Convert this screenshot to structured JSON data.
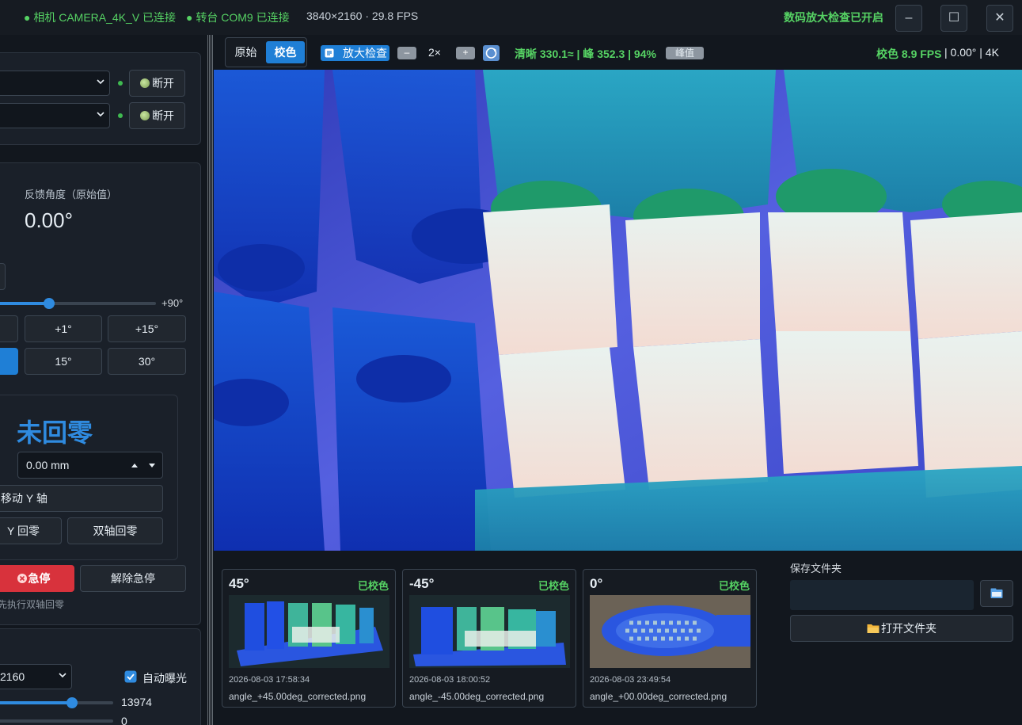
{
  "titlebar": {
    "camera_status": "● 相机 CAMERA_4K_V 已连接",
    "turntable_status": "● 转台 COM9 已连接",
    "resolution": "3840×2160 · 29.8 FPS",
    "zoom_status": "数码放大检查已开启",
    "minimize": "–",
    "maximize": "☐",
    "close": "✕"
  },
  "connection": {
    "disconnect_label_1": "断开",
    "disconnect_label_2": "断开"
  },
  "angle": {
    "feedback_label": "反馈角度（原始值）",
    "feedback_value": "0.00°",
    "slider_max_label": "+90°",
    "slider_level_fraction": 0.56,
    "step_buttons": [
      "+1°",
      "+15°"
    ],
    "preset_buttons": [
      "15°",
      "30°"
    ]
  },
  "axis": {
    "home_status": "未回零",
    "position_value": "0.00 mm",
    "move_y": "移动 Y 轴",
    "y_home": "Y 回零",
    "dual_home": "双轴回零",
    "estop": "急停",
    "release_estop": "解除急停",
    "hint": "先执行双轴回零"
  },
  "camera": {
    "resolution_select": "2160",
    "auto_exposure": "自动曝光",
    "exposure_value": "13974",
    "gain_value": "0",
    "exposure_level_fraction": 0.66,
    "gain_level_fraction": 0.0
  },
  "toolbar": {
    "view_original": "原始",
    "view_corrected": "校色",
    "zoom_check": "放大检查",
    "zoom_minus": "–",
    "zoom_level": "2×",
    "zoom_plus": "+",
    "sharpness_stats": "清晰 330.1≈ | 峰 352.3 | 94%",
    "peak_toggle": "峰值",
    "corrected_fps": "校色 8.9 FPS",
    "rotation": "| 0.00° | 4K"
  },
  "thumbnails": [
    {
      "angle": "45°",
      "status": "已校色",
      "time": "2026-08-03 17:58:34",
      "file": "angle_+45.00deg_corrected.png"
    },
    {
      "angle": "-45°",
      "status": "已校色",
      "time": "2026-08-03 18:00:52",
      "file": "angle_-45.00deg_corrected.png"
    },
    {
      "angle": "0°",
      "status": "已校色",
      "time": "2026-08-03 23:49:54",
      "file": "angle_+00.00deg_corrected.png"
    }
  ],
  "save": {
    "folder_label": "保存文件夹",
    "folder_value": "",
    "open_folder": "打开文件夹"
  },
  "colors": {
    "accent": "#1f7fd6",
    "ok_green": "#56d364",
    "danger": "#d8323c",
    "home_status_blue": "#2f8be0"
  },
  "icons": [
    "chevron-down-icon",
    "folder-icon",
    "open-folder-icon",
    "zoom-icon",
    "refresh-icon",
    "checkbox-checked-icon",
    "stop-icon"
  ]
}
